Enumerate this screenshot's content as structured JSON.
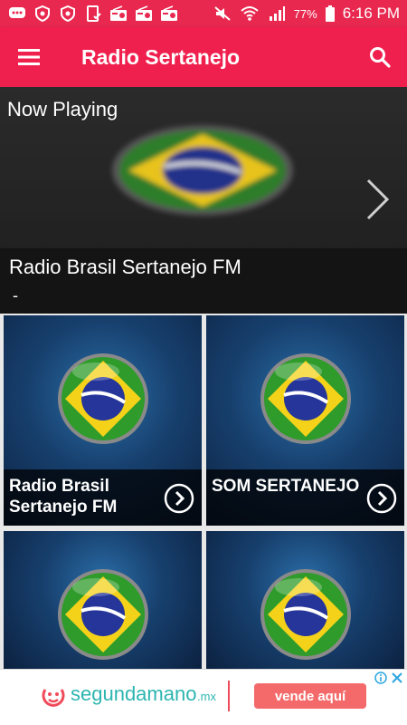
{
  "status_bar": {
    "battery_percent": "77%",
    "time": "6:16 PM",
    "icons": [
      "chat-icon",
      "shield-icon",
      "shield-icon",
      "tablet-check-icon",
      "radio-icon",
      "radio-icon",
      "radio-icon",
      "mute-icon",
      "wifi-icon",
      "signal-icon",
      "battery-icon"
    ]
  },
  "app_bar": {
    "title": "Radio Sertanejo",
    "menu_icon": "hamburger-menu-icon",
    "search_icon": "search-icon"
  },
  "now_playing": {
    "label": "Now Playing",
    "station": "Radio Brasil Sertanejo FM",
    "subtitle": "-",
    "next_icon": "chevron-right-icon"
  },
  "stations": [
    {
      "name": "Radio Brasil Sertanejo FM"
    },
    {
      "name": "SOM SERTANEJO"
    },
    {
      "name": ""
    },
    {
      "name": ""
    }
  ],
  "ad": {
    "brand": "segundamano",
    "tld": ".mx",
    "cta": "vende aquí"
  },
  "colors": {
    "status_bar": "#e8284f",
    "app_bar": "#f0204e",
    "ad_brand": "#2cb5b0",
    "ad_cta": "#f46a6a"
  }
}
